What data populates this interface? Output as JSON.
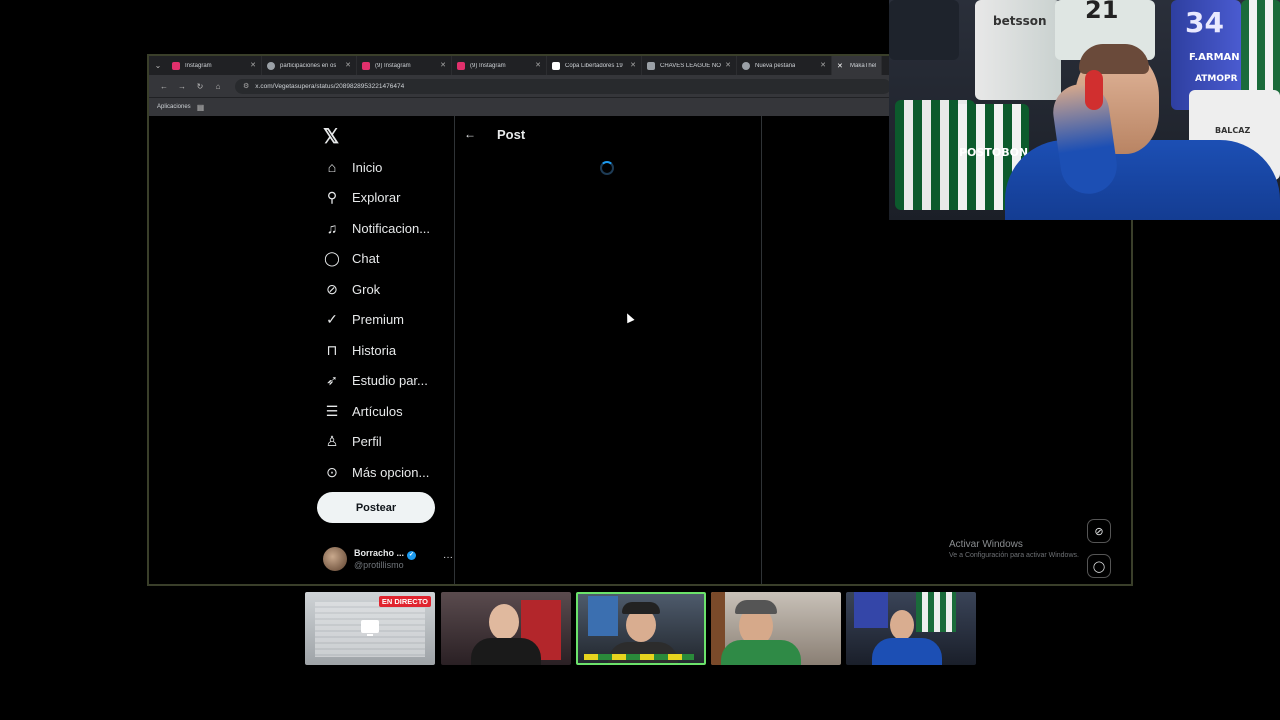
{
  "browser": {
    "tabs": [
      {
        "label": "Instagram",
        "favicon_color": "#e1306c",
        "active": false
      },
      {
        "label": "participaciones en os",
        "favicon_color": "#9aa0a6",
        "active": false
      },
      {
        "label": "(9) Instagram",
        "favicon_color": "#e1306c",
        "active": false
      },
      {
        "label": "(9) Instagram",
        "favicon_color": "#e1306c",
        "active": false
      },
      {
        "label": "Copa Libertadores 19",
        "favicon_color": "#ffffff",
        "active": false
      },
      {
        "label": "CHAVES LEAGUE NO",
        "favicon_color": "#9aa0a6",
        "active": false
      },
      {
        "label": "Nueva pestaña",
        "favicon_color": "#9aa0a6",
        "active": false
      },
      {
        "label": "MakaTheDon",
        "favicon_color": "#ffffff",
        "active": true
      }
    ],
    "url": "x.com/Vegetasupera/status/2089828953221476474",
    "bookmarks_label": "Aplicaciones"
  },
  "x": {
    "logo": "𝕏",
    "nav": [
      {
        "label": "Inicio",
        "icon": "home-icon"
      },
      {
        "label": "Explorar",
        "icon": "search-icon"
      },
      {
        "label": "Notificacion...",
        "icon": "bell-icon"
      },
      {
        "label": "Chat",
        "icon": "chat-icon"
      },
      {
        "label": "Grok",
        "icon": "grok-icon"
      },
      {
        "label": "Premium",
        "icon": "premium-icon"
      },
      {
        "label": "Historia",
        "icon": "bookmark-icon"
      },
      {
        "label": "Estudio par...",
        "icon": "rocket-icon"
      },
      {
        "label": "Artículos",
        "icon": "articles-icon"
      },
      {
        "label": "Perfil",
        "icon": "profile-icon"
      },
      {
        "label": "Más opcion...",
        "icon": "more-icon"
      }
    ],
    "post_button": "Postear",
    "account": {
      "name": "Borracho ...",
      "handle": "@protillismo"
    },
    "main_title": "Post"
  },
  "windows_watermark": {
    "title": "Activar Windows",
    "subtitle": "Ve a Configuración para activar Windows."
  },
  "stream": {
    "live_label": "EN DIRECTO",
    "webcam_texts": [
      "betsson",
      "21",
      "34",
      "F.ARMAN",
      "POSTOBON",
      "ATMOPR",
      "BALCAZ"
    ]
  }
}
